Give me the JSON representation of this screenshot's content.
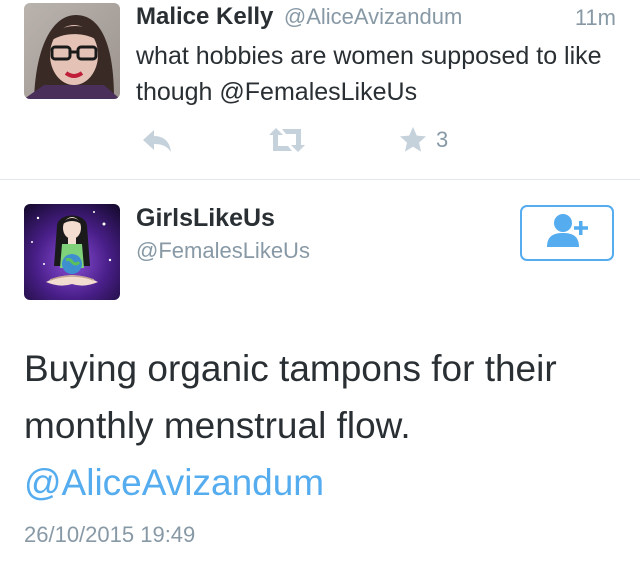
{
  "tweet1": {
    "author_name": "Malice Kelly",
    "handle": "@AliceAvizandum",
    "time": "11m",
    "text": "what hobbies are women supposed to like though @FemalesLikeUs",
    "favorite_count": "3",
    "icons": [
      "reply-icon",
      "retweet-icon",
      "star-icon"
    ]
  },
  "tweet2": {
    "author_name": "GirlsLikeUs",
    "handle": "@FemalesLikeUs",
    "text": "Buying organic tampons for their monthly menstrual flow.",
    "mention": "@AliceAvizandum",
    "timestamp": "26/10/2015 19:49",
    "follow_icon": "add-user-icon"
  },
  "colors": {
    "accent": "#55acee",
    "text": "#292f33",
    "muted": "#8899a6",
    "divider": "#e1e8ed"
  }
}
